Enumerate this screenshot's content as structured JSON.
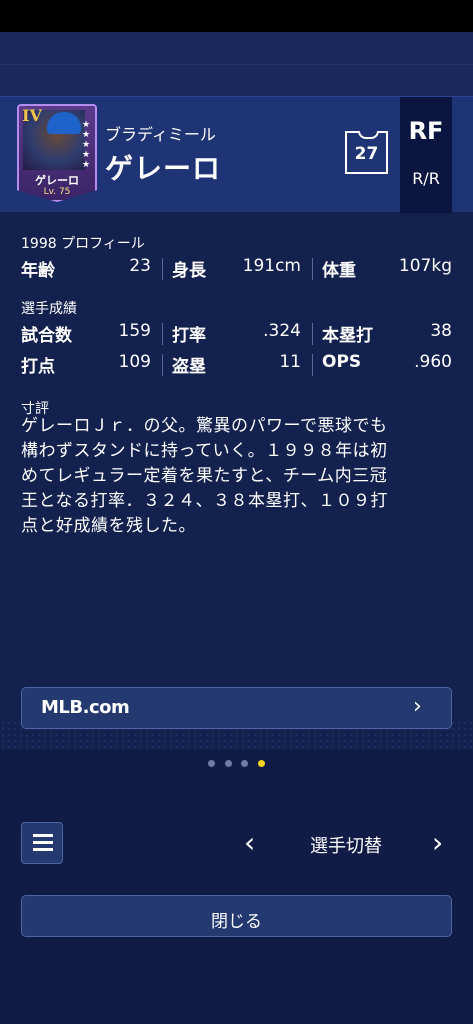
{
  "player": {
    "card_rank": "IV",
    "card_name": "ゲレーロ",
    "card_level": "Lv. 75",
    "name_kana": "ブラディミール",
    "name": "ゲレーロ",
    "number": "27",
    "position": "RF",
    "bats_throws": "R/R"
  },
  "profile": {
    "title": "1998 プロフィール",
    "age_label": "年齢",
    "age": "23",
    "height_label": "身長",
    "height": "191cm",
    "weight_label": "体重",
    "weight": "107kg"
  },
  "stats": {
    "title": "選手成績",
    "games_label": "試合数",
    "games": "159",
    "avg_label": "打率",
    "avg": ".324",
    "hr_label": "本塁打",
    "hr": "38",
    "rbi_label": "打点",
    "rbi": "109",
    "sb_label": "盗塁",
    "sb": "11",
    "ops_label": "OPS",
    "ops": ".960"
  },
  "comment": {
    "title": "寸評",
    "lines": [
      "ゲレーロＪｒ．の父。驚異のパワーで悪球でも",
      "構わずスタンドに持っていく。１９９８年は初",
      "めてレギュラー定着を果たすと、チーム内三冠",
      "王となる打率．３２４、３８本塁打、１０９打",
      "点と好成績を残した。"
    ]
  },
  "link": {
    "label": "MLB.com"
  },
  "pager": {
    "count": 4,
    "active": 3
  },
  "footer": {
    "switch_label": "選手切替",
    "close_label": "閉じる"
  },
  "colors": {
    "background": "#13214f",
    "header": "#1f3475",
    "accent_dot": "#f5d323",
    "button": "#23396f"
  }
}
